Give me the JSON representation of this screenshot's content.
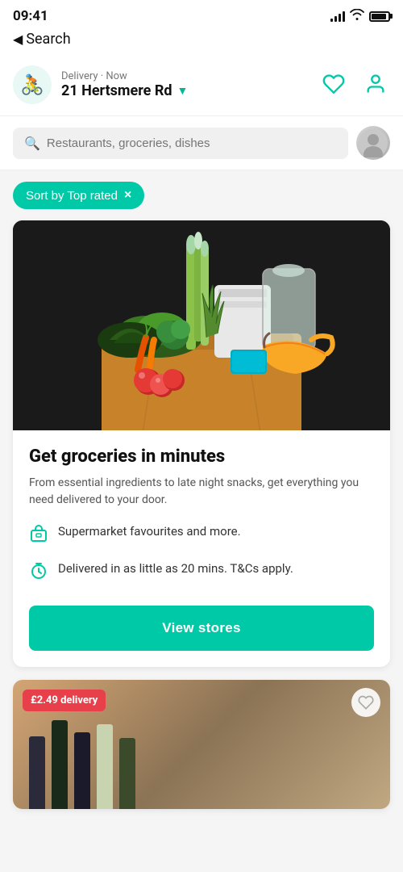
{
  "statusBar": {
    "time": "09:41",
    "batteryLevel": "90"
  },
  "nav": {
    "backText": "Search"
  },
  "header": {
    "deliveryLabel": "Delivery · Now",
    "address": "21 Hertsmere Rd",
    "deliveryIcon": "🚴"
  },
  "search": {
    "placeholder": "Restaurants, groceries, dishes"
  },
  "filter": {
    "label": "Sort by Top rated",
    "closeIcon": "×"
  },
  "groceryCard": {
    "title": "Get groceries in minutes",
    "description": "From essential ingredients to late night snacks, get everything you need delivered to your door.",
    "features": [
      {
        "icon": "🛒",
        "text": "Supermarket favourites and more."
      },
      {
        "icon": "⏱",
        "text": "Delivered in as little as 20 mins. T&Cs apply."
      }
    ],
    "buttonLabel": "View stores"
  },
  "secondCard": {
    "deliveryBadge": "£2.49 delivery"
  }
}
